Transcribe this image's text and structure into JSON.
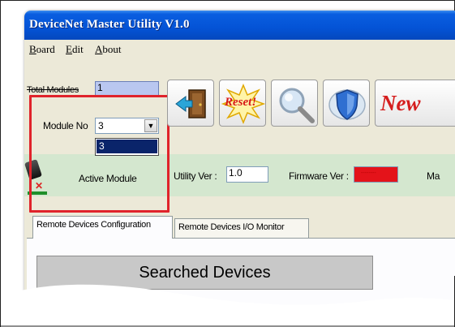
{
  "window": {
    "title": "DeviceNet Master Utility V1.0"
  },
  "menu": {
    "items": [
      {
        "key": "B",
        "rest": "oard"
      },
      {
        "key": "E",
        "rest": "dit"
      },
      {
        "key": "A",
        "rest": "bout"
      }
    ]
  },
  "toolbar": {
    "total_modules_label": "Total Modules",
    "total_modules_value": "1",
    "module_no_label": "Module No",
    "module_no_value": "3",
    "module_no_options": [
      "3"
    ],
    "active_module_label": "Active Module",
    "reset_label": "Reset!",
    "new_label": "New",
    "icons": [
      "exit-door-icon",
      "reset-starburst-icon",
      "magnifier-icon",
      "shield-icon",
      "new-icon"
    ]
  },
  "info": {
    "utility_ver_label": "Utility Ver :",
    "utility_ver_value": "1.0",
    "firmware_ver_label": "Firmware Ver :",
    "firmware_ver_value": "--------",
    "truncated_label": "Ma"
  },
  "tabs": [
    {
      "label": "Remote Devices Configuration",
      "active": true
    },
    {
      "label": "Remote Devices I/O Monitor",
      "active": false
    }
  ],
  "panel": {
    "searched_devices_label": "Searched Devices"
  },
  "colors": {
    "titlebar": "#0453d6",
    "highlight_box": "#e0232b",
    "info_bar": "#d4e7cf",
    "firmware_indicator": "#e4131a",
    "selection": "#0a246a"
  }
}
